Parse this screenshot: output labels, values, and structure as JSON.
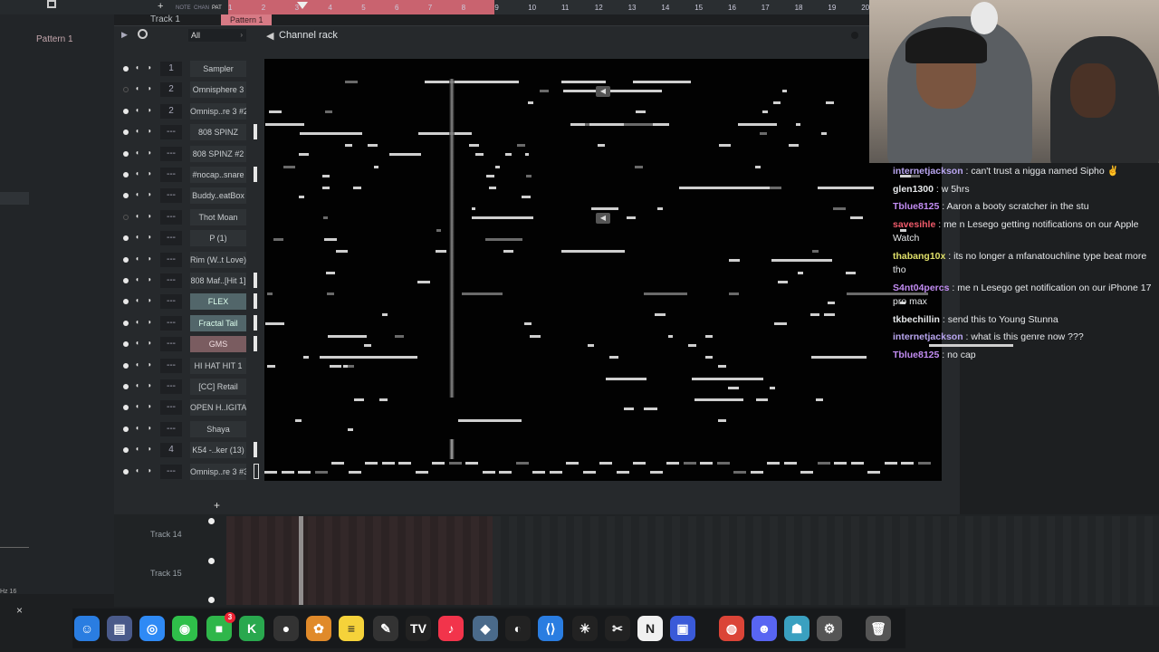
{
  "topbar": {
    "mode_labels": [
      "NOTE",
      "CHAN",
      "PAT"
    ],
    "ruler_numbers": [
      "1",
      "2",
      "3",
      "4",
      "5",
      "6",
      "7",
      "8",
      "9",
      "10",
      "11",
      "12",
      "13",
      "14",
      "15",
      "16",
      "17",
      "18",
      "19",
      "20"
    ],
    "track1": "Track 1",
    "pattern_clip": "Pattern 1"
  },
  "left_panel": {
    "pattern_select": "Pattern 1",
    "hz": "Hz 16",
    "close": "×"
  },
  "rack": {
    "title": "Channel rack",
    "filter": "All",
    "add_symbol": "+",
    "channels": [
      {
        "mixer": "1",
        "name": "Sampler"
      },
      {
        "mixer": "2",
        "name": "Omnisphere 3"
      },
      {
        "mixer": "2",
        "name": "Omnisp..re 3 #2"
      },
      {
        "mixer": "---",
        "name": "808 SPINZ"
      },
      {
        "mixer": "---",
        "name": "808 SPINZ #2"
      },
      {
        "mixer": "---",
        "name": "#nocap..snare"
      },
      {
        "mixer": "---",
        "name": "Buddy..eatBox"
      },
      {
        "mixer": "---",
        "name": "Thot Moan"
      },
      {
        "mixer": "---",
        "name": "P (1)"
      },
      {
        "mixer": "---",
        "name": "Rim (W..t Love)"
      },
      {
        "mixer": "---",
        "name": "808 Maf..[Hit 1]"
      },
      {
        "mixer": "---",
        "name": "FLEX"
      },
      {
        "mixer": "---",
        "name": "Fractal Tail"
      },
      {
        "mixer": "---",
        "name": "GMS"
      },
      {
        "mixer": "---",
        "name": "HI HAT HIT 1"
      },
      {
        "mixer": "---",
        "name": "[CC] Retail"
      },
      {
        "mixer": "---",
        "name": "OPEN H..IGITAL"
      },
      {
        "mixer": "---",
        "name": "Shaya"
      },
      {
        "mixer": "4",
        "name": "K54 -..ker (13)"
      },
      {
        "mixer": "---",
        "name": "Omnisp..re 3 #3"
      }
    ]
  },
  "playlist_lower": {
    "tracks": [
      "Track 14",
      "Track 15"
    ]
  },
  "chat": {
    "messages": [
      {
        "user": "internetjackson",
        "color": "#b9a6f0",
        "text": "can't trust a nigga named Sipho ✌"
      },
      {
        "user": "glen1300",
        "color": "#e6e8ea",
        "text": "w 5hrs"
      },
      {
        "user": "Tblue8125",
        "color": "#c28cf2",
        "text": "Aaron a booty scratcher in the stu"
      },
      {
        "user": "savesihle",
        "color": "#f05a6a",
        "text": "me n Lesego getting notifications on our Apple Watch"
      },
      {
        "user": "thabang10x",
        "color": "#e0e06a",
        "text": "its no longer a mfanatouchline type beat more tho"
      },
      {
        "user": "S4nt04percs",
        "color": "#c28cf2",
        "text": "me n Lesego get notification on our iPhone 17 pro max"
      },
      {
        "user": "tkbechillin",
        "color": "#e6e8ea",
        "text": "send this to Young Stunna"
      },
      {
        "user": "internetjackson",
        "color": "#b9a6f0",
        "text": "what is this genre now ???"
      },
      {
        "user": "Tblue8125",
        "color": "#c28cf2",
        "text": "no cap"
      }
    ]
  },
  "dock": {
    "icons": [
      {
        "name": "finder-icon",
        "glyph": "☺",
        "bg": "#2a7de1"
      },
      {
        "name": "files-icon",
        "glyph": "▤",
        "bg": "#4a5a8a"
      },
      {
        "name": "safari-icon",
        "glyph": "◎",
        "bg": "#2f8af5"
      },
      {
        "name": "messages-icon",
        "glyph": "◉",
        "bg": "#2fbf4a"
      },
      {
        "name": "facetime-icon",
        "glyph": "■",
        "bg": "#2fb64a",
        "badge": "3"
      },
      {
        "name": "kontakt-icon",
        "glyph": "K",
        "bg": "#29a84e"
      },
      {
        "name": "obs-icon",
        "glyph": "●",
        "bg": "#333"
      },
      {
        "name": "fl-studio-icon",
        "glyph": "✿",
        "bg": "#e08a2a"
      },
      {
        "name": "notes-icon",
        "glyph": "≡",
        "bg": "#f5d23a"
      },
      {
        "name": "pen-icon",
        "glyph": "✎",
        "bg": "#333"
      },
      {
        "name": "tradingview-icon",
        "glyph": "TV",
        "bg": "#222"
      },
      {
        "name": "music-icon",
        "glyph": "♪",
        "bg": "#f2344b"
      },
      {
        "name": "davinci-icon",
        "glyph": "◆",
        "bg": "#4a6a8a"
      },
      {
        "name": "github-icon",
        "glyph": "◐",
        "bg": "#222"
      },
      {
        "name": "vscode-icon",
        "glyph": "⟨⟩",
        "bg": "#2a7de1"
      },
      {
        "name": "chatgpt-icon",
        "glyph": "✳",
        "bg": "#222"
      },
      {
        "name": "capcut-icon",
        "glyph": "✂",
        "bg": "#222"
      },
      {
        "name": "notion-icon",
        "glyph": "N",
        "bg": "#f0f0f0"
      },
      {
        "name": "box-icon",
        "glyph": "▣",
        "bg": "#3a5ad8"
      },
      {
        "name": "chrome-icon",
        "glyph": "◍",
        "bg": "#db4437"
      },
      {
        "name": "discord-icon",
        "glyph": "☻",
        "bg": "#5865f2"
      },
      {
        "name": "instruments-icon",
        "glyph": "☗",
        "bg": "#3aa0c0"
      },
      {
        "name": "settings-icon",
        "glyph": "⚙",
        "bg": "#555"
      },
      {
        "name": "trash-icon",
        "glyph": "🗑",
        "bg": "#555"
      }
    ]
  }
}
